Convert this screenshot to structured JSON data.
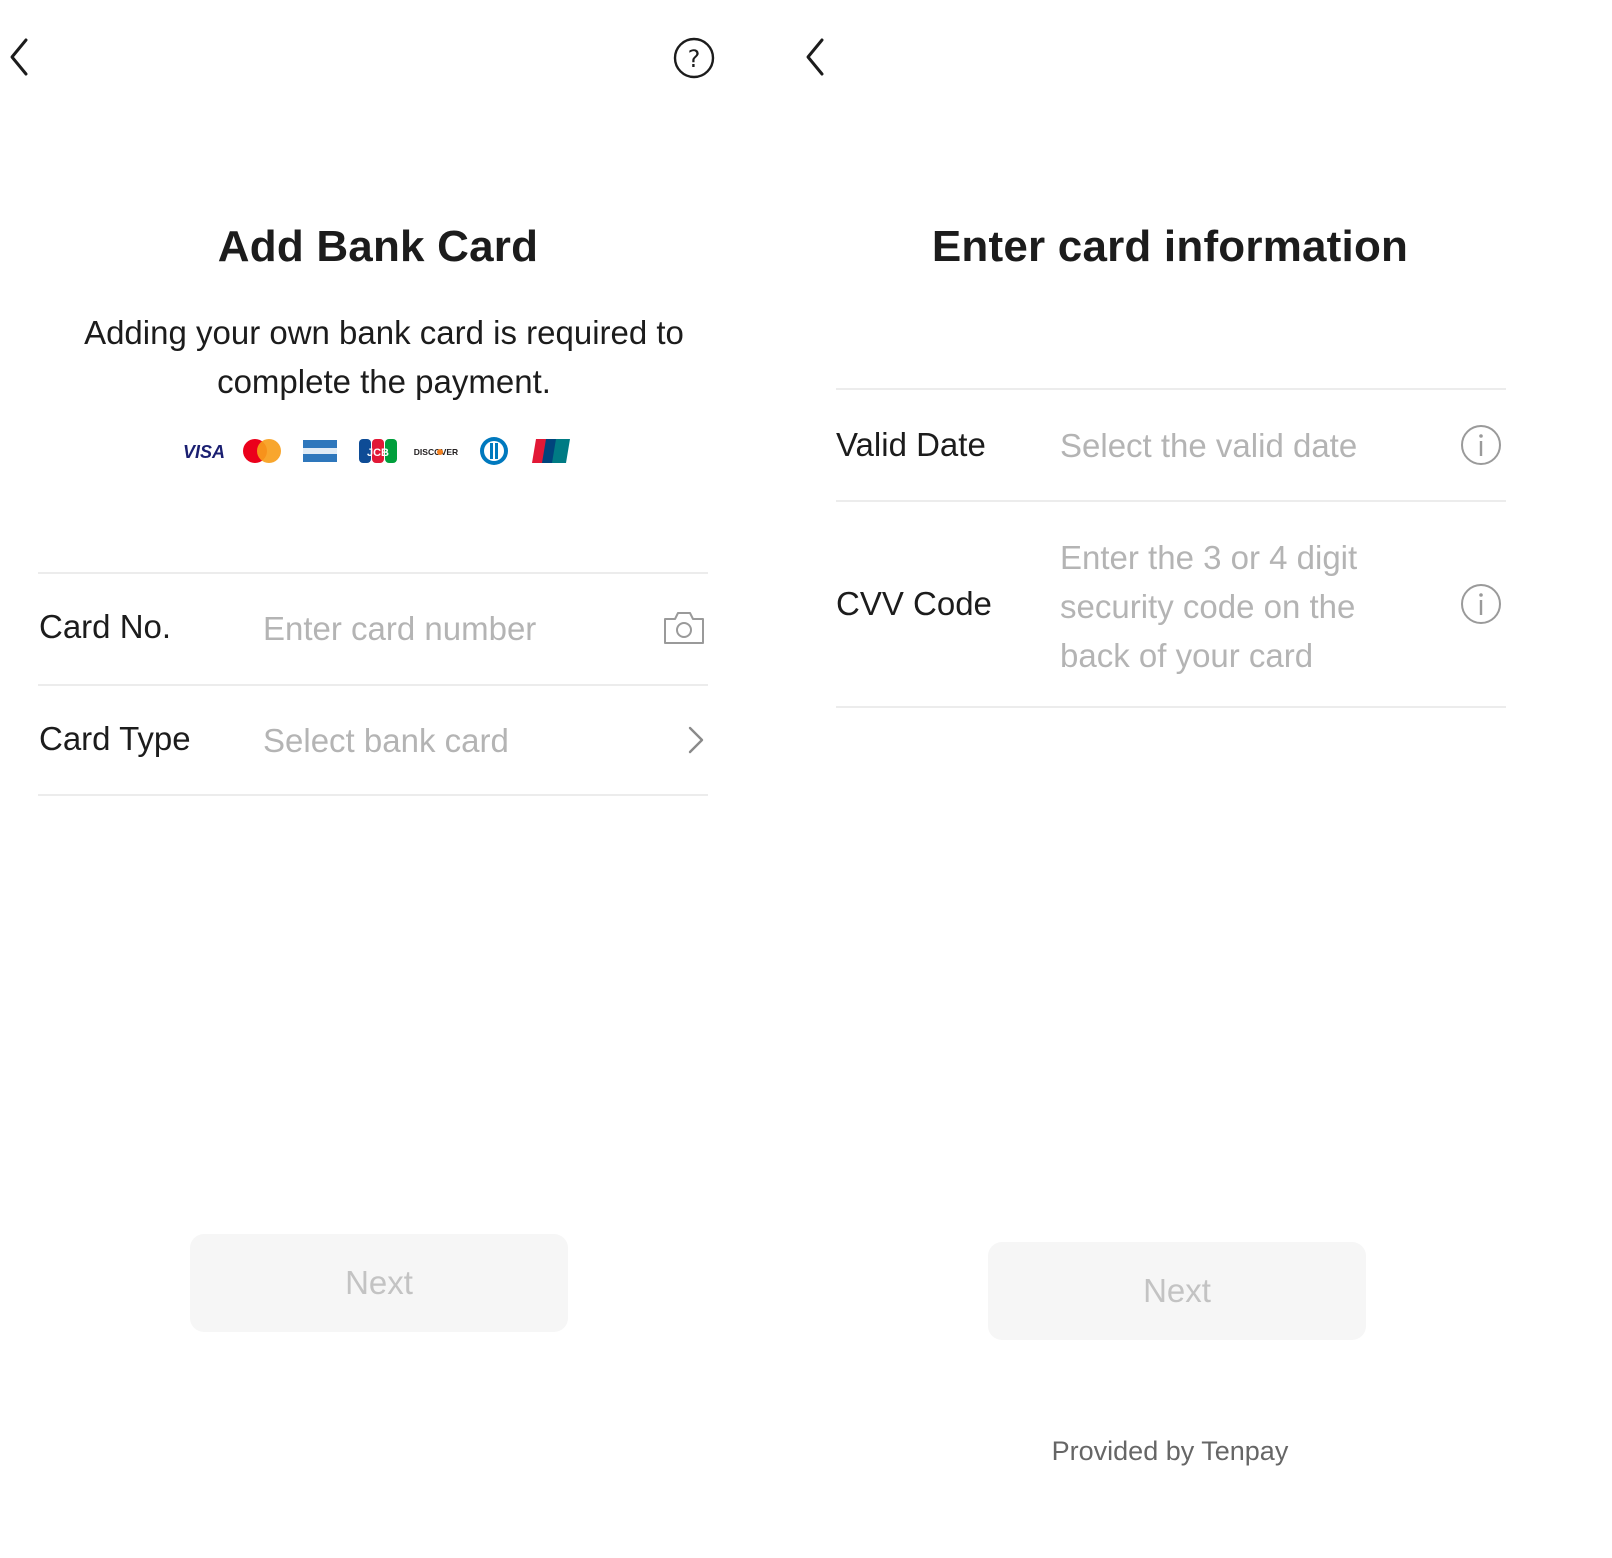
{
  "add_card_screen": {
    "title": "Add Bank Card",
    "subtitle": "Adding your own bank card is required to complete the payment.",
    "card_logos": [
      "VISA",
      "Mastercard",
      "American Express",
      "JCB",
      "DISCOVER",
      "Diners Club",
      "UnionPay"
    ],
    "card_no": {
      "label": "Card No.",
      "placeholder": "Enter card number"
    },
    "card_type": {
      "label": "Card Type",
      "placeholder": "Select bank card"
    },
    "next_label": "Next",
    "icons": {
      "back": "chevron-left-icon",
      "help": "question-circle-icon",
      "camera": "camera-icon",
      "chevron": "chevron-right-icon"
    }
  },
  "card_info_screen": {
    "title": "Enter card information",
    "valid_date": {
      "label": "Valid Date",
      "placeholder": "Select the valid date"
    },
    "cvv": {
      "label": "CVV Code",
      "placeholder": "Enter the 3 or 4 digit security code on the back of your card"
    },
    "next_label": "Next",
    "footer": "Provided by Tenpay",
    "icons": {
      "back": "chevron-left-icon",
      "info": "info-circle-icon"
    }
  },
  "colors": {
    "text_primary": "#1c1c1c",
    "placeholder": "#b4b4b4",
    "divider": "#ececec",
    "button_bg_disabled": "#f6f6f6",
    "button_text_disabled": "#c3c3c3"
  }
}
